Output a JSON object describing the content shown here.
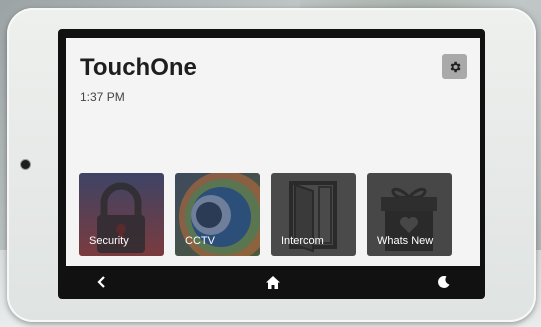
{
  "app": {
    "title": "TouchOne",
    "time": "1:37 PM"
  },
  "header": {
    "settings_icon": "gear-icon"
  },
  "tiles": [
    {
      "label": "Security",
      "icon": "lock-icon"
    },
    {
      "label": "CCTV",
      "icon": "camera-icon"
    },
    {
      "label": "Intercom",
      "icon": "door-icon"
    },
    {
      "label": "Whats New",
      "icon": "gift-icon"
    }
  ],
  "nav": {
    "back_icon": "chevron-left-icon",
    "home_icon": "home-icon",
    "night_icon": "moon-icon"
  },
  "colors": {
    "screen_bg": "#f4f4f4",
    "navbar_bg": "#111111",
    "title_text": "#1e1e1e"
  }
}
